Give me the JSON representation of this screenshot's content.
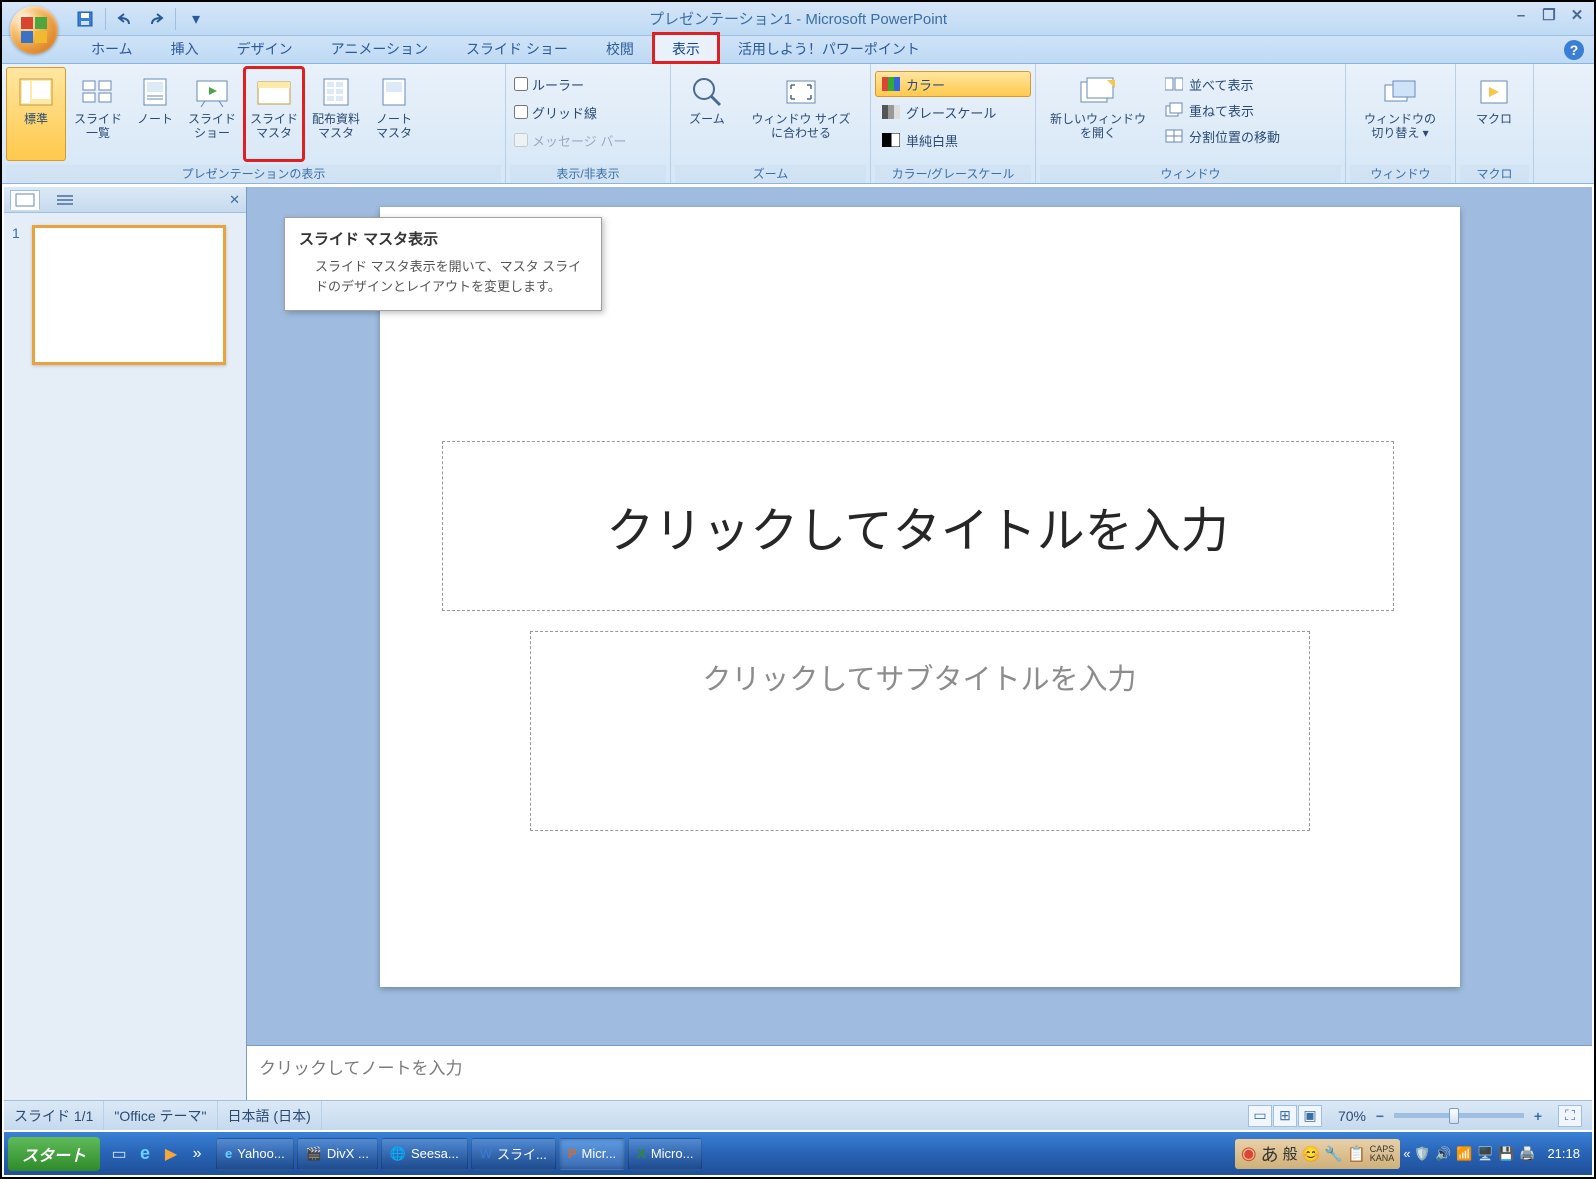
{
  "title": "プレゼンテーション1 - Microsoft PowerPoint",
  "tabs": [
    "ホーム",
    "挿入",
    "デザイン",
    "アニメーション",
    "スライド ショー",
    "校閲",
    "表示",
    "活用しよう！パワーポイント"
  ],
  "activeTab": "表示",
  "ribbon": {
    "group1": {
      "label": "プレゼンテーションの表示",
      "btn_normal": "標準",
      "btn_sorter": "スライド\n一覧",
      "btn_notes": "ノート",
      "btn_slideshow": "スライド\nショー",
      "btn_master": "スライド\nマスタ",
      "btn_handout": "配布資料\nマスタ",
      "btn_notesmaster": "ノート\nマスタ"
    },
    "group2": {
      "label": "表示/非表示",
      "ruler": "ルーラー",
      "grid": "グリッド線",
      "msgbar": "メッセージ バー"
    },
    "group3": {
      "label": "ズーム",
      "zoom": "ズーム",
      "fit": "ウィンドウ サイズ\nに合わせる"
    },
    "group4": {
      "label": "カラー/グレースケール",
      "color": "カラー",
      "gray": "グレースケール",
      "bw": "単純白黒"
    },
    "group5": {
      "label": "ウィンドウ",
      "newwin": "新しいウィンドウ\nを開く",
      "arrange": "並べて表示",
      "cascade": "重ねて表示",
      "split": "分割位置の移動"
    },
    "group6": {
      "label": "",
      "switch": "ウィンドウの\n切り替え ▾"
    },
    "group7": {
      "label": "マクロ",
      "macro": "マクロ"
    }
  },
  "tooltip": {
    "title": "スライド マスタ表示",
    "body": "スライド マスタ表示を開いて、マスタ スライドのデザインとレイアウトを変更します。"
  },
  "slide": {
    "title_ph": "クリックしてタイトルを入力",
    "sub_ph": "クリックしてサブタイトルを入力"
  },
  "notes_ph": "クリックしてノートを入力",
  "status": {
    "slide": "スライド 1/1",
    "theme": "\"Office テーマ\"",
    "lang": "日本語 (日本)",
    "zoom": "70%"
  },
  "thumb_num": "1",
  "taskbar": {
    "start": "スタート",
    "items": [
      "Yahoo...",
      "DivX ...",
      "Seesa...",
      "スライ...",
      "Micr...",
      "Micro..."
    ],
    "active_index": 4,
    "ime": {
      "a": "あ",
      "han": "般"
    },
    "caps": "CAPS",
    "kana": "KANA",
    "clock": "21:18"
  }
}
